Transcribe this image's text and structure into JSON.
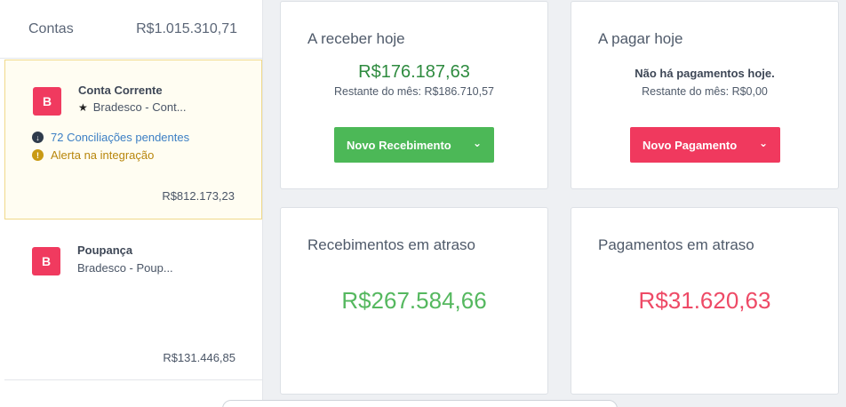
{
  "accounts": {
    "title": "Contas",
    "total": "R$1.015.310,71",
    "items": [
      {
        "logo": "B",
        "name": "Conta Corrente",
        "bank": "Bradesco - Cont...",
        "pending": "72 Conciliações pendentes",
        "alert": "Alerta na integração",
        "balance": "R$812.173,23"
      },
      {
        "logo": "B",
        "name": "Poupança",
        "bank": "Bradesco - Poup...",
        "balance": "R$131.446,85"
      }
    ]
  },
  "receive_today": {
    "title": "A receber hoje",
    "value": "R$176.187,63",
    "sub": "Restante do mês: R$186.710,57",
    "button": "Novo Recebimento"
  },
  "pay_today": {
    "title": "A pagar hoje",
    "note": "Não há pagamentos hoje.",
    "sub": "Restante do mês: R$0,00",
    "button": "Novo Pagamento"
  },
  "overdue_receipts": {
    "title": "Recebimentos em atraso",
    "value": "R$267.584,66"
  },
  "overdue_payments": {
    "title": "Pagamentos em atraso",
    "value": "R$31.620,63"
  },
  "icons": {
    "star": "★",
    "chevron": "⌄",
    "pending": "↓",
    "alert": "!"
  },
  "colors": {
    "accent_green": "#4cb857",
    "accent_red": "#f0395e",
    "bank_brand": "#f03a5f",
    "link_blue": "#3c7fc4",
    "alert_gold": "#b8860b"
  }
}
